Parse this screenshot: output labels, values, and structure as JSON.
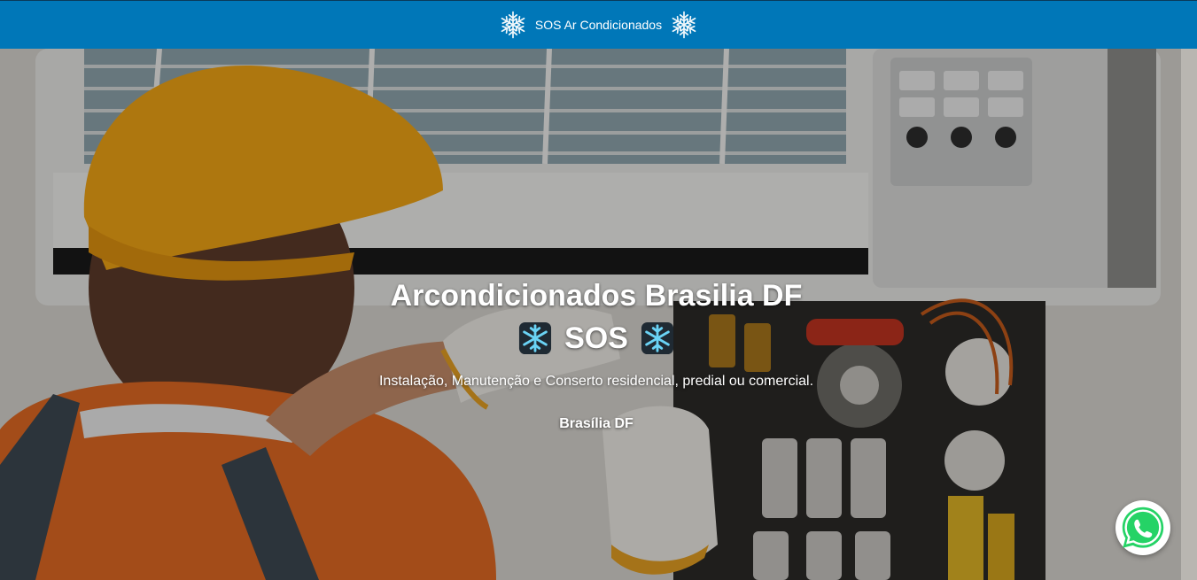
{
  "header": {
    "brand": "SOS Ar Condicionados",
    "left_icon": "snowflake-icon",
    "right_icon": "snowflake-icon",
    "background_color": "#0077b8"
  },
  "hero": {
    "title": "Arcondicionados Brasilia DF",
    "sos_label": "SOS",
    "sos_icons": [
      "snowflake-emoji-icon",
      "snowflake-emoji-icon"
    ],
    "description": "Instalação, Manutenção e Conserto residencial, predial ou comercial.",
    "location": "Brasília DF",
    "background_icon": "technician-repairing-air-conditioner-photo"
  },
  "floating": {
    "whatsapp_icon": "whatsapp-icon",
    "whatsapp_color": "#25d366"
  }
}
